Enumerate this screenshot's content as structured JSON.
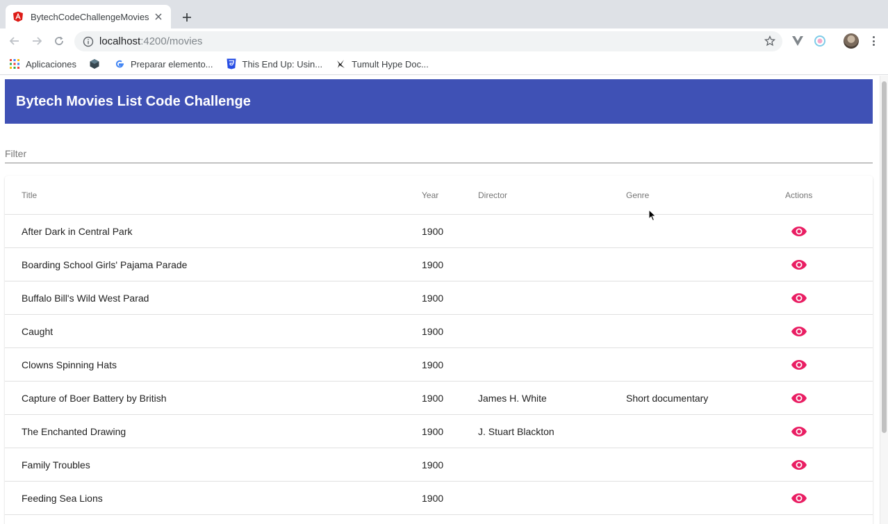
{
  "browser": {
    "tab_title": "BytechCodeChallengeMovies",
    "url_host": "localhost",
    "url_path": ":4200/movies",
    "bookmarks": [
      {
        "label": "Aplicaciones",
        "icon": "apps-grid-icon"
      },
      {
        "label": "",
        "icon": "cube-icon"
      },
      {
        "label": "Preparar elemento...",
        "icon": "google-icon"
      },
      {
        "label": "This End Up: Usin...",
        "icon": "css3-icon"
      },
      {
        "label": "Tumult Hype Doc...",
        "icon": "hype-icon"
      }
    ]
  },
  "app": {
    "title": "Bytech Movies List Code Challenge",
    "filter_placeholder": "Filter",
    "accent_color": "#3f51b5",
    "action_color": "#e91e63"
  },
  "table": {
    "columns": {
      "title": "Title",
      "year": "Year",
      "director": "Director",
      "genre": "Genre",
      "actions": "Actions"
    },
    "rows": [
      {
        "title": "After Dark in Central Park",
        "year": "1900",
        "director": "",
        "genre": ""
      },
      {
        "title": "Boarding School Girls' Pajama Parade",
        "year": "1900",
        "director": "",
        "genre": ""
      },
      {
        "title": "Buffalo Bill's Wild West Parad",
        "year": "1900",
        "director": "",
        "genre": ""
      },
      {
        "title": "Caught",
        "year": "1900",
        "director": "",
        "genre": ""
      },
      {
        "title": "Clowns Spinning Hats",
        "year": "1900",
        "director": "",
        "genre": ""
      },
      {
        "title": "Capture of Boer Battery by British",
        "year": "1900",
        "director": "James H. White",
        "genre": "Short documentary"
      },
      {
        "title": "The Enchanted Drawing",
        "year": "1900",
        "director": "J. Stuart Blackton",
        "genre": ""
      },
      {
        "title": "Family Troubles",
        "year": "1900",
        "director": "",
        "genre": ""
      },
      {
        "title": "Feeding Sea Lions",
        "year": "1900",
        "director": "",
        "genre": ""
      }
    ]
  }
}
